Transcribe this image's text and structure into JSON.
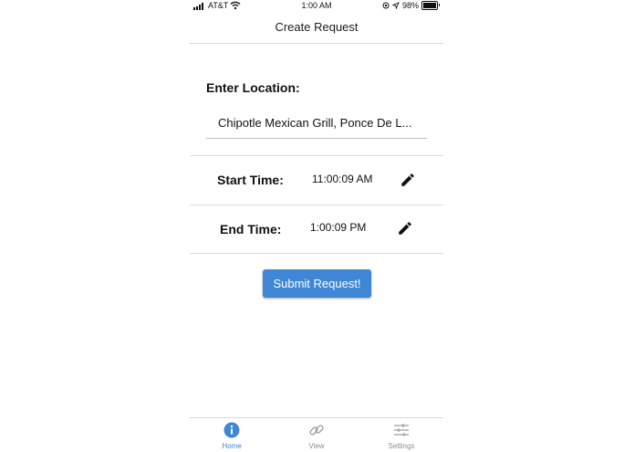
{
  "status_bar": {
    "carrier": "AT&T",
    "time": "1:00 AM",
    "battery": "98%",
    "battery_level": 0.98
  },
  "nav": {
    "title": "Create Request"
  },
  "form": {
    "location_label": "Enter Location:",
    "location_value": "Chipotle Mexican Grill, Ponce De L...",
    "start_label": "Start Time:",
    "start_value": "11:00:09 AM",
    "end_label": "End Time:",
    "end_value": "1:00:09 PM",
    "submit_label": "Submit Request!"
  },
  "tabs": [
    {
      "label": "Home",
      "icon": "info-icon",
      "active": true
    },
    {
      "label": "View",
      "icon": "link-icon",
      "active": false
    },
    {
      "label": "Settings",
      "icon": "sliders-icon",
      "active": false
    }
  ],
  "colors": {
    "accent": "#3f87d4",
    "inactive": "#8e8e93"
  }
}
